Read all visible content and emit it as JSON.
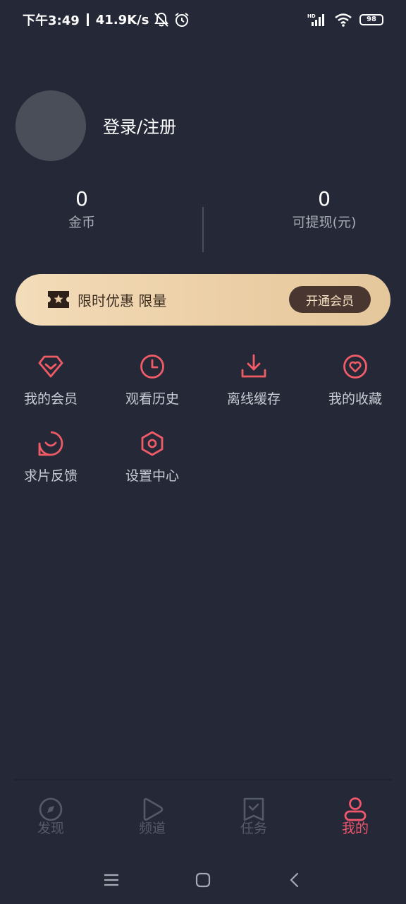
{
  "status_bar": {
    "time": "下午3:49",
    "speed": "41.9K/s",
    "signal_label": "HD",
    "battery": "98"
  },
  "profile": {
    "login_label": "登录/注册"
  },
  "stats": {
    "coins": {
      "value": "0",
      "label": "金币"
    },
    "cash": {
      "value": "0",
      "label": "可提现(元)"
    }
  },
  "promo": {
    "text": "限时优惠 限量",
    "button": "开通会员"
  },
  "grid": {
    "items": [
      {
        "label": "我的会员",
        "icon": "diamond-icon"
      },
      {
        "label": "观看历史",
        "icon": "clock-icon"
      },
      {
        "label": "离线缓存",
        "icon": "download-icon"
      },
      {
        "label": "我的收藏",
        "icon": "heart-icon"
      },
      {
        "label": "求片反馈",
        "icon": "feedback-icon"
      },
      {
        "label": "设置中心",
        "icon": "settings-icon"
      }
    ]
  },
  "bottom_nav": {
    "items": [
      {
        "label": "发现",
        "icon": "compass-icon",
        "active": false
      },
      {
        "label": "频道",
        "icon": "play-icon",
        "active": false
      },
      {
        "label": "任务",
        "icon": "task-icon",
        "active": false
      },
      {
        "label": "我的",
        "icon": "user-icon",
        "active": true
      }
    ]
  },
  "colors": {
    "background": "#252937",
    "accent": "#f0566d",
    "promo_gold": "#eccfa6",
    "inactive_nav": "#555a6a"
  }
}
